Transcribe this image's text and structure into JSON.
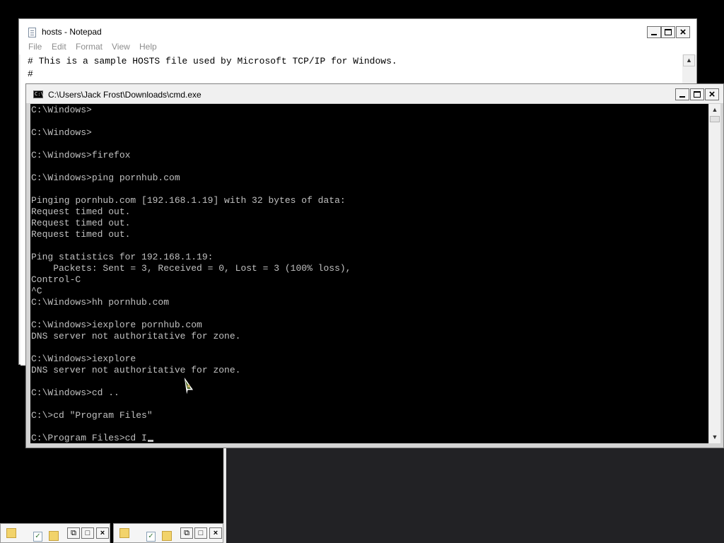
{
  "notepad": {
    "title": "hosts - Notepad",
    "menu": [
      "File",
      "Edit",
      "Format",
      "View",
      "Help"
    ],
    "lines": [
      "# This is a sample HOSTS file used by Microsoft TCP/IP for Windows.",
      "#"
    ]
  },
  "cmd": {
    "title": "C:\\Users\\Jack Frost\\Downloads\\cmd.exe",
    "lines": [
      "C:\\Windows>",
      "",
      "C:\\Windows>",
      "",
      "C:\\Windows>firefox",
      "",
      "C:\\Windows>ping pornhub.com",
      "",
      "Pinging pornhub.com [192.168.1.19] with 32 bytes of data:",
      "Request timed out.",
      "Request timed out.",
      "Request timed out.",
      "",
      "Ping statistics for 192.168.1.19:",
      "    Packets: Sent = 3, Received = 0, Lost = 3 (100% loss),",
      "Control-C",
      "^C",
      "C:\\Windows>hh pornhub.com",
      "",
      "C:\\Windows>iexplore pornhub.com",
      "DNS server not authoritative for zone.",
      "",
      "C:\\Windows>iexplore",
      "DNS server not authoritative for zone.",
      "",
      "C:\\Windows>cd ..",
      "",
      "C:\\>cd \"Program Files\"",
      "",
      "C:\\Program Files>cd I"
    ]
  },
  "window_buttons": {
    "minimize": "minimize",
    "maximize": "maximize",
    "close": "close"
  },
  "colors": {
    "console_bg": "#000000",
    "console_text": "#c0c0c0",
    "chrome": "#f0f0f0"
  }
}
